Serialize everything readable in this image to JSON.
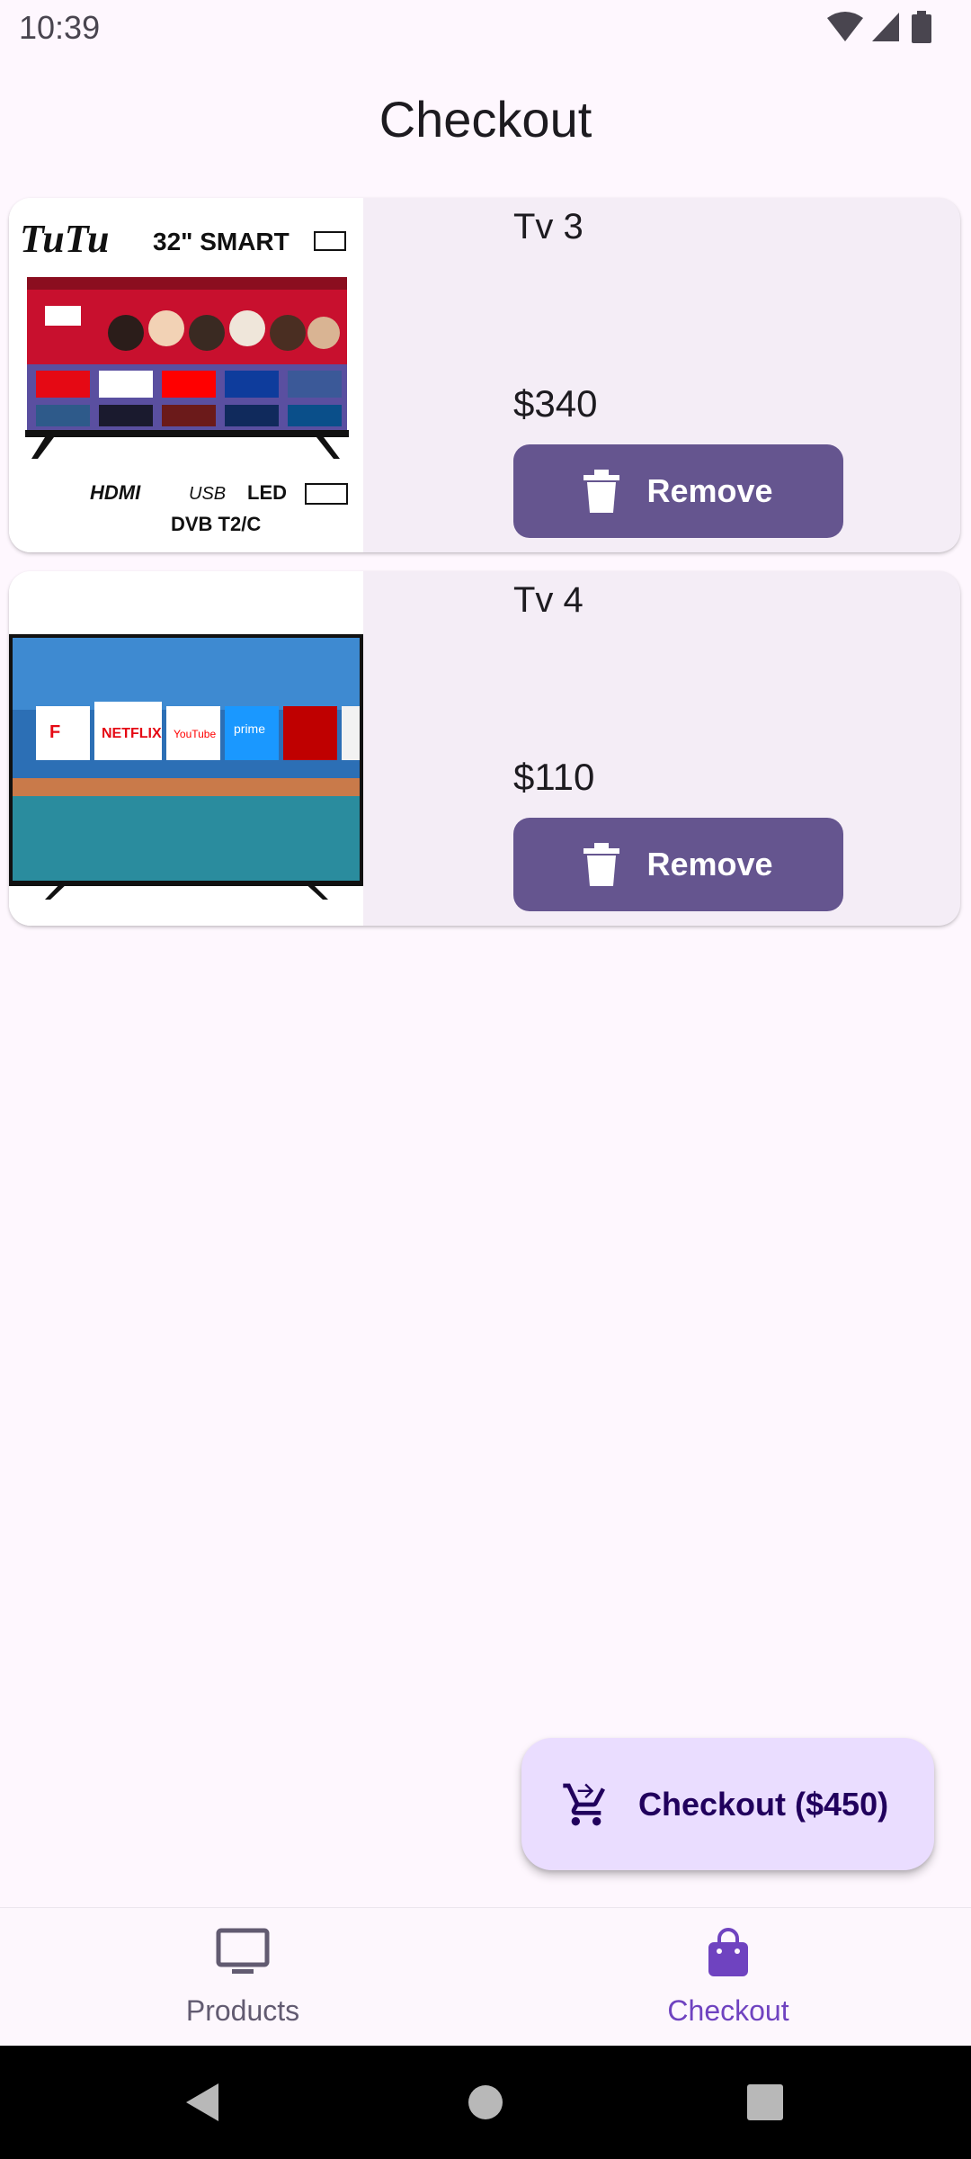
{
  "status_bar": {
    "time": "10:39",
    "icons": [
      "wifi-icon",
      "signal-icon",
      "battery-icon"
    ]
  },
  "page": {
    "title": "Checkout"
  },
  "cart_items": [
    {
      "name": "Tv 3",
      "price": "$340",
      "remove_label": "Remove",
      "image_icon": "tv-product-image"
    },
    {
      "name": "Tv 4",
      "price": "$110",
      "remove_label": "Remove",
      "image_icon": "tv-product-image"
    }
  ],
  "fab": {
    "label": "Checkout ($450)",
    "icon": "cart-icon"
  },
  "bottom_nav": {
    "items": [
      {
        "label": "Products",
        "icon": "tv-icon",
        "selected": false
      },
      {
        "label": "Checkout",
        "icon": "shopping-bag-icon",
        "selected": true
      }
    ]
  },
  "colors": {
    "background": "#FEF7FE",
    "card": "#F4EDF6",
    "primary_button": "#65558F",
    "fab": "#EADDFF",
    "nav_selected": "#6F43C0",
    "nav_unselected": "#625B71"
  }
}
